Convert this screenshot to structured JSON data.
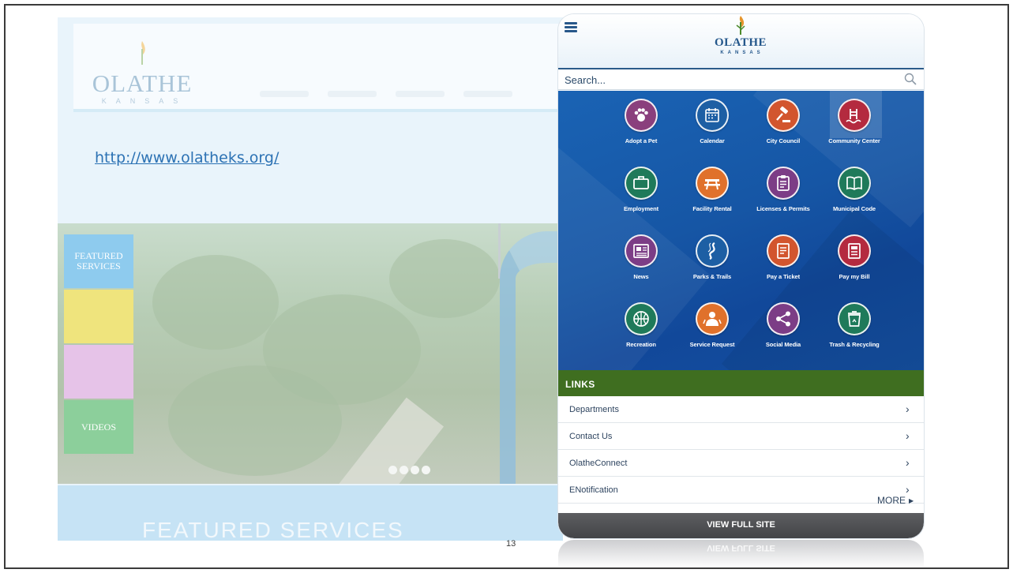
{
  "desktop_site": {
    "logo_word": "OLATHE",
    "logo_sub": "KANSAS",
    "url": "http://www.olatheks.org/",
    "tabs": [
      "FEATURED SERVICES",
      "",
      "",
      "VIDEOS"
    ],
    "banner_title": "FEATURED SERVICES"
  },
  "slide": {
    "page_number": "13"
  },
  "mobile": {
    "logo_word": "OLATHE",
    "logo_sub": "KANSAS",
    "search_placeholder": "Search...",
    "services": [
      {
        "label": "Adopt a Pet",
        "icon": "paw-icon",
        "color": "#8a3f7d"
      },
      {
        "label": "Calendar",
        "icon": "calendar-icon",
        "color": "#1d5fa4"
      },
      {
        "label": "City Council",
        "icon": "gavel-icon",
        "color": "#d2552e"
      },
      {
        "label": "Community Center",
        "icon": "pool-icon",
        "color": "#b42a3f"
      },
      {
        "label": "Employment",
        "icon": "briefcase-icon",
        "color": "#1f7a5a"
      },
      {
        "label": "Facility Rental",
        "icon": "picnic-table-icon",
        "color": "#e0712b"
      },
      {
        "label": "Licenses & Permits",
        "icon": "clipboard-icon",
        "color": "#7c3d86"
      },
      {
        "label": "Municipal Code",
        "icon": "book-icon",
        "color": "#1f7a5a"
      },
      {
        "label": "News",
        "icon": "newspaper-icon",
        "color": "#7c3d86"
      },
      {
        "label": "Parks & Trails",
        "icon": "trail-icon",
        "color": "#1d5fa4"
      },
      {
        "label": "Pay a Ticket",
        "icon": "ticket-icon",
        "color": "#d2552e"
      },
      {
        "label": "Pay my Bill",
        "icon": "bill-icon",
        "color": "#b42a3f"
      },
      {
        "label": "Recreation",
        "icon": "basketball-icon",
        "color": "#1f7a5a"
      },
      {
        "label": "Service Request",
        "icon": "service-request-icon",
        "color": "#e0712b"
      },
      {
        "label": "Social Media",
        "icon": "share-icon",
        "color": "#7c3d86"
      },
      {
        "label": "Trash & Recycling",
        "icon": "trash-can-icon",
        "color": "#1f7a5a"
      }
    ],
    "links_header": "LINKS",
    "links": [
      {
        "label": "Departments"
      },
      {
        "label": "Contact Us"
      },
      {
        "label": "OlatheConnect"
      },
      {
        "label": "ENotification"
      }
    ],
    "more_label": "MORE",
    "view_full_site": "VIEW FULL SITE"
  },
  "colors": {
    "brand_blue": "#1656a5",
    "links_green": "#3f6e20",
    "footer_gray": "#4f5053"
  }
}
